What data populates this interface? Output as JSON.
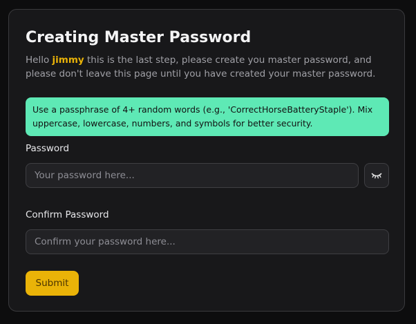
{
  "title": "Creating Master Password",
  "intro": {
    "greeting": "Hello",
    "username": "jimmy",
    "message": "this is the last step, please create you master password, and please don't leave this page until you have created your master password."
  },
  "tip": "Use a passphrase of 4+ random words (e.g., 'CorrectHorseBatteryStaple'). Mix uppercase, lowercase, numbers, and symbols for better security.",
  "password": {
    "label": "Password",
    "placeholder": "Your password here...",
    "value": "",
    "toggle_icon": "eye-closed-icon"
  },
  "confirm": {
    "label": "Confirm Password",
    "placeholder": "Confirm your password here...",
    "value": ""
  },
  "submit_label": "Submit",
  "colors": {
    "accent": "#eab308",
    "tip_background": "#5ee9b5",
    "card_background": "#18181a",
    "page_background": "#0d0d0e"
  }
}
